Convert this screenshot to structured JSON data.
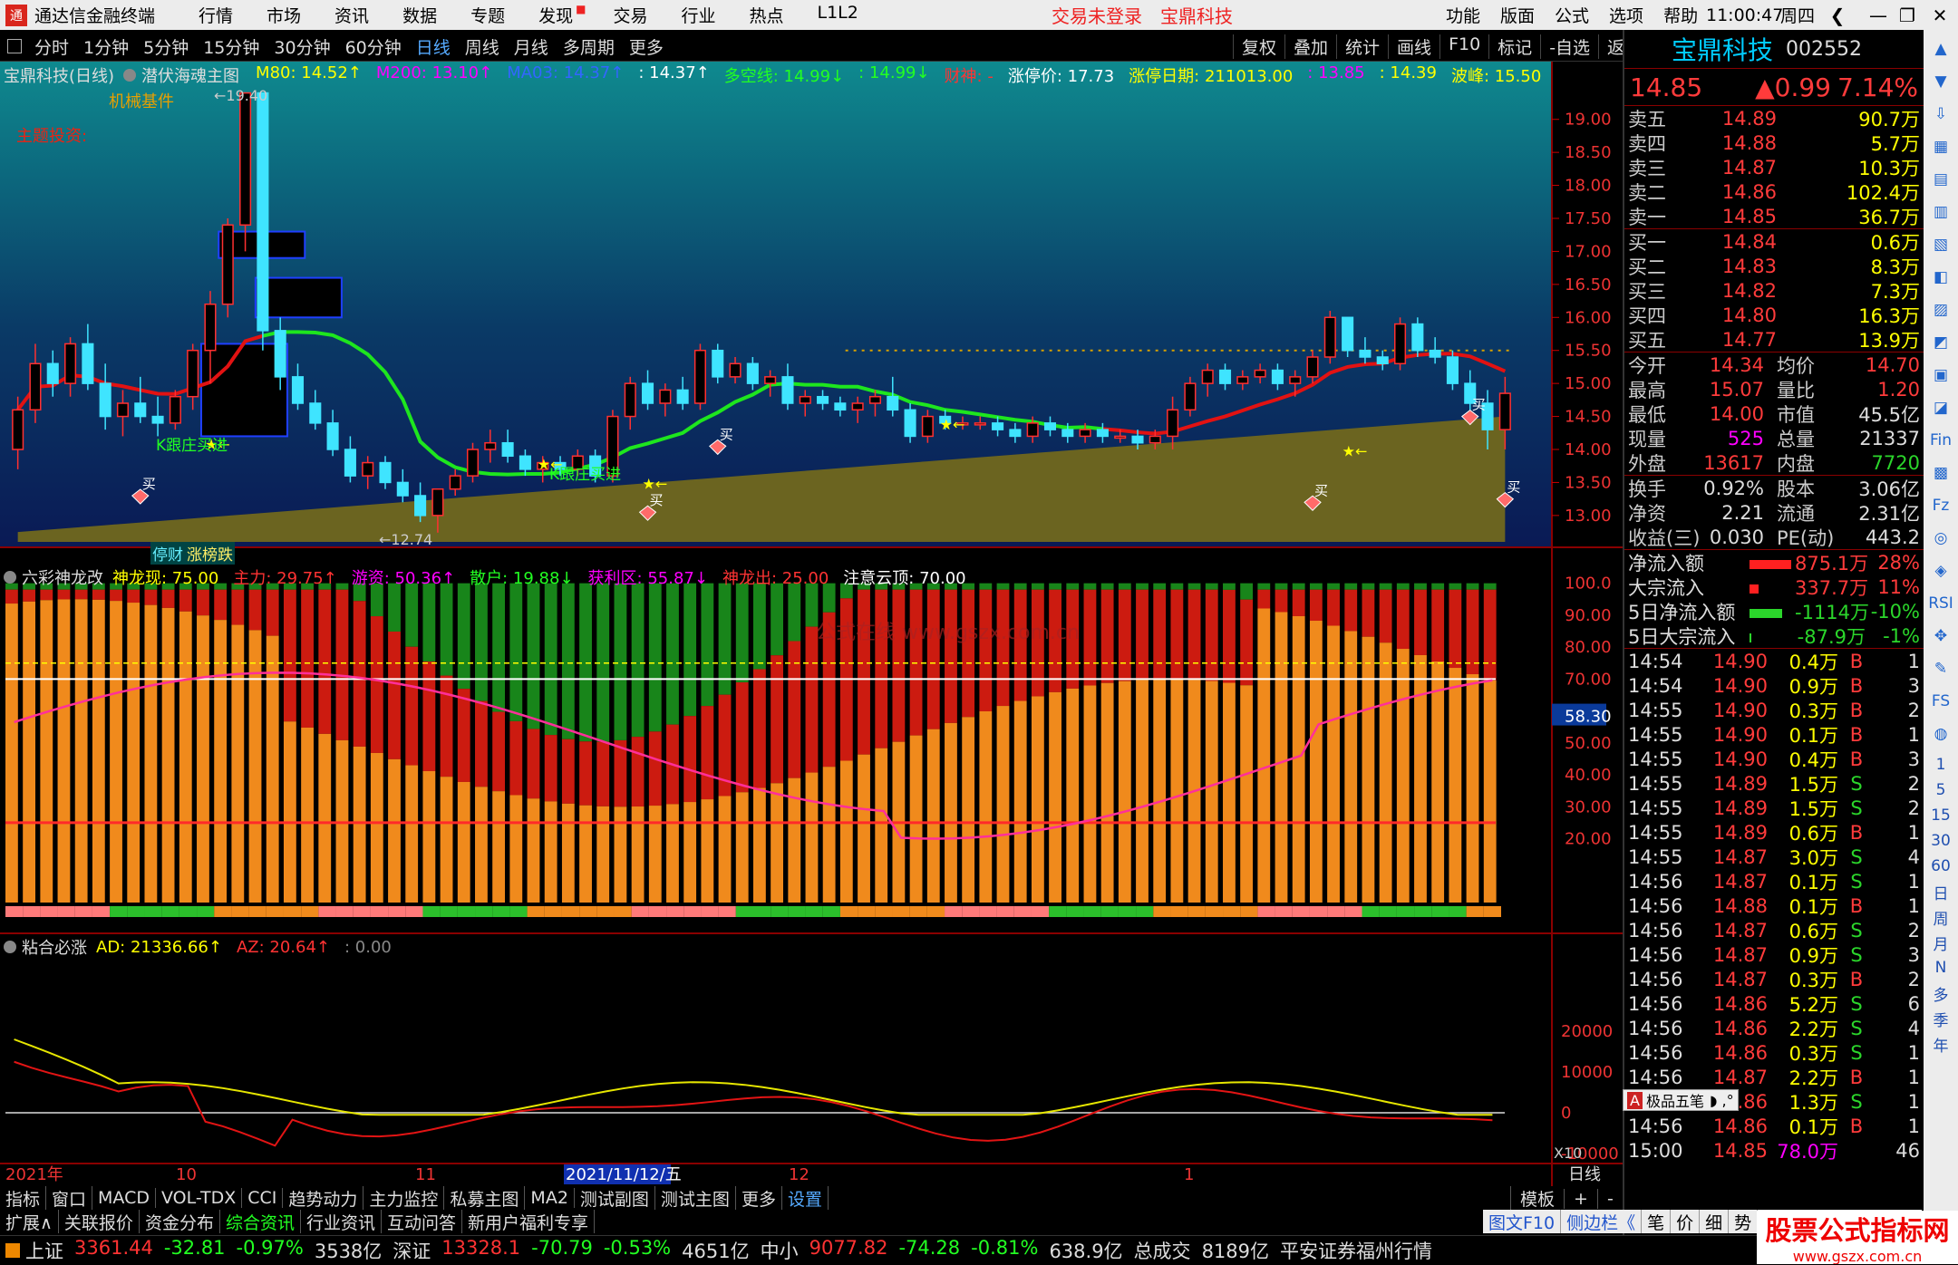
{
  "app": {
    "title": "通达信金融终端",
    "menu": [
      "行情",
      "市场",
      "资讯",
      "数据",
      "专题",
      "发现",
      "交易",
      "行业",
      "热点",
      "L1L2"
    ],
    "center_alert": "交易未登录",
    "center_stock": "宝鼎科技",
    "right_menu": [
      "功能",
      "版面",
      "公式",
      "选项",
      "帮助"
    ],
    "time": "11:00:47",
    "weekday": "周四"
  },
  "toolbar": {
    "periods": [
      "分时",
      "1分钟",
      "5分钟",
      "15分钟",
      "30分钟",
      "60分钟",
      "日线",
      "周线",
      "月线",
      "多周期",
      "更多"
    ],
    "active": "日线",
    "right": [
      "复权",
      "叠加",
      "统计",
      "画线",
      "F10",
      "标记",
      "-自选",
      "返回"
    ]
  },
  "main_header": {
    "stock": "宝鼎科技(日线)",
    "formula": "潜伏海魂主图",
    "items": [
      {
        "t": "M80: 14.52↑",
        "c": "#ff0"
      },
      {
        "t": "M200: 13.10↑",
        "c": "#f0f"
      },
      {
        "t": "MA03: 14.37↑",
        "c": "#36f"
      },
      {
        "t": ": 14.37↑",
        "c": "#fff"
      },
      {
        "t": "多空线: 14.99↓",
        "c": "#2f2"
      },
      {
        "t": ": 14.99↓",
        "c": "#2f2"
      },
      {
        "t": "财神: -",
        "c": "#f33"
      },
      {
        "t": "涨停价: 17.73",
        "c": "#fff"
      },
      {
        "t": "涨停日期: 211013.00",
        "c": "#ff0"
      },
      {
        "t": ": 13.85",
        "c": "#f0f"
      },
      {
        "t": ": 14.39",
        "c": "#ff0"
      },
      {
        "t": "波峰: 15.50",
        "c": "#ff0"
      }
    ]
  },
  "main_labels": {
    "sector": "机械基件",
    "theme": "主题投资:",
    "high": "←19.40",
    "low": "←12.74",
    "follow1": "K跟庄买进",
    "follow2": "K跟庄买进",
    "buy": "买",
    "tags": [
      "停财",
      "涨榜跌"
    ]
  },
  "price_axis": [
    "19.00",
    "18.50",
    "18.00",
    "17.50",
    "17.00",
    "16.50",
    "16.00",
    "15.50",
    "15.00",
    "14.50",
    "14.00",
    "13.50",
    "13.00"
  ],
  "osc1": {
    "name": "六彩神龙改",
    "items": [
      {
        "t": "神龙现: 75.00",
        "c": "#ff0"
      },
      {
        "t": "主力: 29.75↑",
        "c": "#f33"
      },
      {
        "t": "游资: 50.36↑",
        "c": "#f0f"
      },
      {
        "t": "散户: 19.88↓",
        "c": "#2f2"
      },
      {
        "t": "获利区: 55.87↓",
        "c": "#f0f"
      },
      {
        "t": "神龙出: 25.00",
        "c": "#f33"
      },
      {
        "t": "注意云顶: 70.00",
        "c": "#fff"
      }
    ],
    "axis": [
      "100.0",
      "90.00",
      "80.00",
      "70.00",
      "58.30",
      "50.00",
      "40.00",
      "30.00",
      "20.00"
    ],
    "watermark": "公式在线  www.gszx.com.cn"
  },
  "osc2": {
    "name": "粘合必涨",
    "items": [
      {
        "t": "AD: 21336.66↑",
        "c": "#ff0"
      },
      {
        "t": "AZ: 20.64↑",
        "c": "#f33"
      },
      {
        "t": ": 0.00",
        "c": "#888"
      }
    ],
    "axis": [
      "20000",
      "10000",
      "0",
      "-10000"
    ],
    "corner": "X10"
  },
  "date_axis": [
    "2021年",
    "10",
    "11",
    "2021/11/12/五",
    "12",
    "1"
  ],
  "date_axis_right": "日线",
  "tabs": [
    "指标",
    "窗口",
    "MACD",
    "VOL-TDX",
    "CCI",
    "趋势动力",
    "主力监控",
    "私募主图",
    "MA2",
    "测试副图",
    "测试主图",
    "更多",
    "设置"
  ],
  "tabs_right": [
    "模板",
    "+",
    "-"
  ],
  "tabs2": [
    "扩展∧",
    "关联报价",
    "资金分布",
    "综合资讯",
    "行业资讯",
    "互动问答",
    "新用户福利专享"
  ],
  "quote": {
    "name": "宝鼎科技",
    "code": "002552",
    "price": "14.85",
    "change": "▲0.99",
    "pct": "7.14%",
    "asks": [
      [
        "卖五",
        "14.89",
        "90.7万"
      ],
      [
        "卖四",
        "14.88",
        "5.7万"
      ],
      [
        "卖三",
        "14.87",
        "10.3万"
      ],
      [
        "卖二",
        "14.86",
        "102.4万"
      ],
      [
        "卖一",
        "14.85",
        "36.7万"
      ]
    ],
    "bids": [
      [
        "买一",
        "14.84",
        "0.6万"
      ],
      [
        "买二",
        "14.83",
        "8.3万"
      ],
      [
        "买三",
        "14.82",
        "7.3万"
      ],
      [
        "买四",
        "14.80",
        "16.3万"
      ],
      [
        "买五",
        "14.77",
        "13.9万"
      ]
    ],
    "stats": [
      [
        "今开",
        "14.34",
        "均价",
        "14.70"
      ],
      [
        "最高",
        "15.07",
        "量比",
        "1.20"
      ],
      [
        "最低",
        "14.00",
        "市值",
        "45.5亿"
      ],
      [
        "现量",
        "525",
        "总量",
        "21337"
      ],
      [
        "外盘",
        "13617",
        "内盘",
        "7720"
      ]
    ],
    "stats2": [
      [
        "换手",
        "0.92%",
        "股本",
        "3.06亿"
      ],
      [
        "净资",
        "2.21",
        "流通",
        "2.31亿"
      ],
      [
        "收益(三)",
        "0.030",
        "PE(动)",
        "443.2"
      ]
    ],
    "flows": [
      [
        "净流入额",
        "875.1万",
        "28%"
      ],
      [
        "大宗流入",
        "337.7万",
        "11%"
      ],
      [
        "5日净流入额",
        "-1114万",
        "-10%"
      ],
      [
        "5日大宗流入",
        "-87.9万",
        "-1%"
      ]
    ],
    "ticks": [
      [
        "14:54",
        "14.90",
        "0.4万",
        "B",
        "1"
      ],
      [
        "14:54",
        "14.90",
        "0.9万",
        "B",
        "3"
      ],
      [
        "14:55",
        "14.90",
        "0.3万",
        "B",
        "2"
      ],
      [
        "14:55",
        "14.90",
        "0.1万",
        "B",
        "1"
      ],
      [
        "14:55",
        "14.90",
        "0.4万",
        "B",
        "3"
      ],
      [
        "14:55",
        "14.89",
        "1.5万",
        "S",
        "2"
      ],
      [
        "14:55",
        "14.89",
        "1.5万",
        "S",
        "2"
      ],
      [
        "14:55",
        "14.89",
        "0.6万",
        "B",
        "1"
      ],
      [
        "14:55",
        "14.87",
        "3.0万",
        "S",
        "4"
      ],
      [
        "14:56",
        "14.87",
        "0.1万",
        "S",
        "1"
      ],
      [
        "14:56",
        "14.88",
        "0.1万",
        "B",
        "1"
      ],
      [
        "14:56",
        "14.87",
        "0.6万",
        "S",
        "2"
      ],
      [
        "14:56",
        "14.87",
        "0.9万",
        "S",
        "3"
      ],
      [
        "14:56",
        "14.87",
        "0.3万",
        "B",
        "2"
      ],
      [
        "14:56",
        "14.86",
        "5.2万",
        "S",
        "6"
      ],
      [
        "14:56",
        "14.86",
        "2.2万",
        "S",
        "4"
      ],
      [
        "14:56",
        "14.86",
        "0.3万",
        "S",
        "1"
      ],
      [
        "14:56",
        "14.87",
        "2.2万",
        "B",
        "1"
      ],
      [
        "14:56",
        "14.86",
        "1.3万",
        "S",
        "1"
      ],
      [
        "14:56",
        "14.86",
        "0.1万",
        "B",
        "1"
      ],
      [
        "15:00",
        "14.85",
        "78.0万",
        "",
        "46"
      ]
    ],
    "popup": "极品五笔"
  },
  "right_bottom": [
    "图文F10",
    "侧边栏《",
    "笔",
    "价",
    "细",
    "势"
  ],
  "status": [
    {
      "t": "上证",
      "c": "#ddd"
    },
    {
      "t": "3361.44",
      "c": "#f33"
    },
    {
      "t": "-32.81",
      "c": "#2f2"
    },
    {
      "t": "-0.97%",
      "c": "#2f2"
    },
    {
      "t": "3538亿",
      "c": "#ddd"
    },
    {
      "t": "深证",
      "c": "#ddd"
    },
    {
      "t": "13328.1",
      "c": "#f33"
    },
    {
      "t": "-70.79",
      "c": "#2f2"
    },
    {
      "t": "-0.53%",
      "c": "#2f2"
    },
    {
      "t": "4651亿",
      "c": "#ddd"
    },
    {
      "t": "中小",
      "c": "#ddd"
    },
    {
      "t": "9077.82",
      "c": "#f33"
    },
    {
      "t": "-74.28",
      "c": "#2f2"
    },
    {
      "t": "-0.81%",
      "c": "#2f2"
    },
    {
      "t": "638.9亿",
      "c": "#ddd"
    },
    {
      "t": "总成交",
      "c": "#ddd"
    },
    {
      "t": "8189亿",
      "c": "#ddd"
    },
    {
      "t": "平安证券福州行情",
      "c": "#ddd"
    }
  ],
  "brand": {
    "name": "股票公式指标网",
    "url": "www.gszx.com.cn"
  },
  "sidebar_labels": [
    "1",
    "5",
    "15",
    "30",
    "60",
    "日",
    "周",
    "月",
    "N",
    "多",
    "季",
    "年"
  ],
  "chart_data": [
    {
      "type": "candlestick",
      "title": "宝鼎科技(日线)",
      "y_axis": [
        "19.00",
        "13.00"
      ],
      "ylim": [
        12.6,
        19.6
      ],
      "note": "approximate daily OHLC read from candles",
      "ohlc": [
        [
          14.0,
          14.8,
          13.7,
          14.6
        ],
        [
          14.6,
          15.6,
          14.4,
          15.3
        ],
        [
          15.3,
          15.5,
          14.8,
          15.0
        ],
        [
          15.0,
          15.7,
          14.8,
          15.6
        ],
        [
          15.6,
          15.9,
          14.9,
          15.0
        ],
        [
          15.0,
          15.3,
          14.3,
          14.5
        ],
        [
          14.5,
          14.9,
          14.2,
          14.7
        ],
        [
          14.7,
          15.1,
          14.4,
          14.5
        ],
        [
          14.5,
          14.8,
          14.2,
          14.4
        ],
        [
          14.4,
          14.9,
          14.3,
          14.8
        ],
        [
          14.8,
          15.6,
          14.6,
          15.5
        ],
        [
          15.5,
          16.4,
          15.0,
          16.2
        ],
        [
          16.2,
          17.5,
          16.0,
          17.4
        ],
        [
          17.4,
          19.4,
          17.0,
          19.4
        ],
        [
          19.4,
          19.4,
          15.5,
          15.8
        ],
        [
          15.8,
          16.0,
          14.9,
          15.1
        ],
        [
          15.1,
          15.3,
          14.6,
          14.7
        ],
        [
          14.7,
          14.9,
          14.3,
          14.4
        ],
        [
          14.4,
          14.6,
          13.9,
          14.0
        ],
        [
          14.0,
          14.2,
          13.5,
          13.6
        ],
        [
          13.6,
          13.9,
          13.4,
          13.8
        ],
        [
          13.8,
          13.9,
          13.4,
          13.5
        ],
        [
          13.5,
          13.7,
          13.2,
          13.3
        ],
        [
          13.3,
          13.5,
          12.9,
          13.0
        ],
        [
          13.0,
          13.4,
          12.74,
          13.4
        ],
        [
          13.4,
          13.7,
          13.3,
          13.6
        ],
        [
          13.6,
          14.1,
          13.5,
          14.0
        ],
        [
          14.0,
          14.3,
          13.8,
          14.1
        ],
        [
          14.1,
          14.3,
          13.8,
          13.9
        ],
        [
          13.9,
          14.0,
          13.6,
          13.7
        ],
        [
          13.7,
          13.9,
          13.5,
          13.8
        ],
        [
          13.8,
          13.9,
          13.6,
          13.7
        ],
        [
          13.7,
          14.0,
          13.6,
          13.9
        ],
        [
          13.9,
          14.0,
          13.5,
          13.6
        ],
        [
          13.6,
          14.6,
          13.5,
          14.5
        ],
        [
          14.5,
          15.1,
          14.3,
          15.0
        ],
        [
          15.0,
          15.2,
          14.6,
          14.7
        ],
        [
          14.7,
          15.0,
          14.5,
          14.9
        ],
        [
          14.9,
          15.1,
          14.6,
          14.7
        ],
        [
          14.7,
          15.6,
          14.6,
          15.5
        ],
        [
          15.5,
          15.6,
          15.0,
          15.1
        ],
        [
          15.1,
          15.4,
          15.0,
          15.3
        ],
        [
          15.3,
          15.4,
          14.9,
          15.0
        ],
        [
          15.0,
          15.2,
          14.8,
          15.1
        ],
        [
          15.1,
          15.3,
          14.6,
          14.7
        ],
        [
          14.7,
          14.9,
          14.5,
          14.8
        ],
        [
          14.8,
          14.9,
          14.6,
          14.7
        ],
        [
          14.7,
          14.8,
          14.5,
          14.6
        ],
        [
          14.6,
          14.8,
          14.4,
          14.7
        ],
        [
          14.7,
          14.9,
          14.5,
          14.8
        ],
        [
          14.8,
          15.1,
          14.5,
          14.6
        ],
        [
          14.6,
          14.7,
          14.1,
          14.2
        ],
        [
          14.2,
          14.6,
          14.1,
          14.5
        ],
        [
          14.5,
          14.6,
          14.3,
          14.4
        ],
        [
          14.4,
          14.5,
          14.3,
          14.4
        ],
        [
          14.4,
          14.5,
          14.3,
          14.4
        ],
        [
          14.4,
          14.5,
          14.2,
          14.3
        ],
        [
          14.3,
          14.4,
          14.1,
          14.2
        ],
        [
          14.2,
          14.5,
          14.1,
          14.4
        ],
        [
          14.4,
          14.5,
          14.2,
          14.3
        ],
        [
          14.3,
          14.4,
          14.1,
          14.2
        ],
        [
          14.2,
          14.4,
          14.1,
          14.3
        ],
        [
          14.3,
          14.4,
          14.1,
          14.2
        ],
        [
          14.2,
          14.3,
          14.1,
          14.2
        ],
        [
          14.2,
          14.3,
          14.0,
          14.1
        ],
        [
          14.1,
          14.3,
          14.0,
          14.2
        ],
        [
          14.2,
          14.8,
          14.0,
          14.6
        ],
        [
          14.6,
          15.1,
          14.5,
          15.0
        ],
        [
          15.0,
          15.3,
          14.8,
          15.2
        ],
        [
          15.2,
          15.3,
          14.9,
          15.0
        ],
        [
          15.0,
          15.2,
          14.9,
          15.1
        ],
        [
          15.1,
          15.3,
          15.0,
          15.2
        ],
        [
          15.2,
          15.3,
          14.9,
          15.0
        ],
        [
          15.0,
          15.2,
          14.8,
          15.1
        ],
        [
          15.1,
          15.5,
          15.0,
          15.4
        ],
        [
          15.4,
          16.1,
          15.3,
          16.0
        ],
        [
          16.0,
          16.0,
          15.4,
          15.5
        ],
        [
          15.5,
          15.7,
          15.3,
          15.4
        ],
        [
          15.4,
          15.5,
          15.2,
          15.3
        ],
        [
          15.3,
          16.0,
          15.2,
          15.9
        ],
        [
          15.9,
          16.0,
          15.4,
          15.5
        ],
        [
          15.5,
          15.7,
          15.3,
          15.4
        ],
        [
          15.4,
          15.5,
          14.9,
          15.0
        ],
        [
          15.0,
          15.2,
          14.6,
          14.7
        ],
        [
          14.7,
          14.9,
          14.0,
          14.3
        ],
        [
          14.3,
          15.1,
          14.0,
          14.85
        ]
      ],
      "ma_red_from": 0,
      "levels": {
        "dotted": 15.5,
        "high": 19.4,
        "low": 12.74
      }
    },
    {
      "type": "bar",
      "title": "六彩神龙改",
      "ylim": [
        0,
        100
      ],
      "series": [
        {
          "name": "神龙现",
          "values": [
            75
          ]
        },
        {
          "name": "主力",
          "values": [
            29.75
          ]
        },
        {
          "name": "游资",
          "values": [
            50.36
          ]
        },
        {
          "name": "散户",
          "values": [
            19.88
          ]
        },
        {
          "name": "获利区",
          "values": [
            55.87
          ]
        },
        {
          "name": "神龙出",
          "values": [
            25
          ]
        },
        {
          "name": "注意云顶",
          "values": [
            70
          ]
        }
      ]
    },
    {
      "type": "line",
      "title": "粘合必涨",
      "ylim": [
        -15000,
        25000
      ],
      "series": [
        {
          "name": "AD",
          "values": [
            21336.66
          ]
        },
        {
          "name": "AZ",
          "values": [
            20.64
          ]
        }
      ]
    }
  ]
}
